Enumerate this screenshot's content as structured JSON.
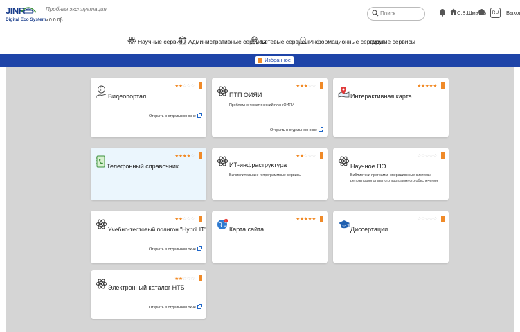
{
  "header": {
    "logo_title": "JINR",
    "logo_subtitle": "Digital Eco System",
    "status_text": "Пробная эксплуатация",
    "version": "v.0.0.0β",
    "search_placeholder": "Поиск",
    "user_name": "С.В.Шматов",
    "language": "RU",
    "logout_label": "Выход"
  },
  "nav": {
    "items": [
      {
        "label": "Научные сервисы",
        "icon": "atom-icon"
      },
      {
        "label": "Административные сервисы",
        "icon": "building-icon"
      },
      {
        "label": "Сетевые сервисы",
        "icon": "network-icon"
      },
      {
        "label": "Информационные сервисы",
        "icon": "info-person-icon"
      },
      {
        "label": "Другие сервисы",
        "icon": ""
      }
    ]
  },
  "favorites_tab": "Избранное",
  "colors": {
    "primary": "#1e44a8",
    "accent": "#f08a28",
    "highlight_card": "#ebf6fd",
    "background": "#d5d5d5"
  },
  "cards": [
    {
      "title": "Видеопортал",
      "description": "",
      "rating": 2,
      "open_link": "Открыть в отдельном окне",
      "icon": "video-portal-icon"
    },
    {
      "title": "ПТП ОИЯИ",
      "description": "Проблемно-тематический план ОИЯИ",
      "rating": 3,
      "open_link": "Открыть в отдельном окне",
      "icon": "atom-icon"
    },
    {
      "title": "Интерактивная карта",
      "description": "",
      "rating": 5,
      "open_link": "",
      "icon": "map-pin-icon"
    },
    {
      "title": "Телефонный справочник",
      "description": "",
      "rating": 4,
      "open_link": "",
      "icon": "phone-book-icon"
    },
    {
      "title": "ИТ-инфраструктура",
      "description": "Вычислительные и программные сервисы",
      "rating": 2,
      "open_link": "",
      "icon": "atom-icon"
    },
    {
      "title": "Научное ПО",
      "description": "Библиотеки программ, операционные системы, репозитории открытого программного обеспечения",
      "rating": 0,
      "open_link": "",
      "icon": "atom-icon"
    },
    {
      "title": "Учебно-тестовый полигон \"HybriLIT\"",
      "description": "",
      "rating": 2,
      "open_link": "Открыть в отдельном окне",
      "icon": "atom-icon"
    },
    {
      "title": "Карта сайта",
      "description": "",
      "rating": 5,
      "open_link": "",
      "icon": "globe-icon"
    },
    {
      "title": "Диссертации",
      "description": "",
      "rating": 0,
      "open_link": "",
      "icon": "graduation-cap-icon"
    },
    {
      "title": "Электронный каталог НТБ",
      "description": "",
      "rating": 2,
      "open_link": "Открыть в отдельном окне",
      "icon": "atom-icon"
    }
  ]
}
